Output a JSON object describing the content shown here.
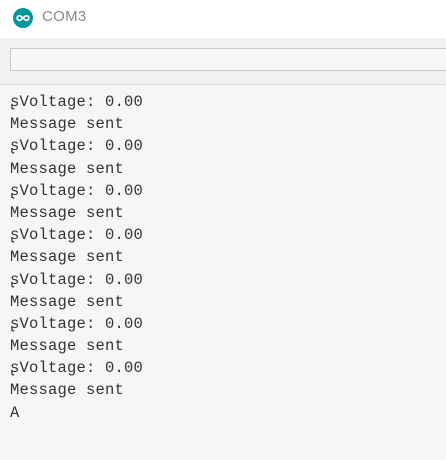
{
  "window": {
    "title": "COM3",
    "app_icon": "infinity-icon",
    "accent": "#00979c"
  },
  "send_field": {
    "value": "",
    "placeholder": ""
  },
  "output": {
    "lines": [
      "ʂVoltage: 0.00",
      "Message sent",
      "ʂVoltage: 0.00",
      "Message sent",
      "ʂVoltage: 0.00",
      "Message sent",
      "ʂVoltage: 0.00",
      "Message sent",
      "ʂVoltage: 0.00",
      "Message sent",
      "ʂVoltage: 0.00",
      "Message sent",
      "ʂVoltage: 0.00",
      "Message sent",
      "A"
    ]
  }
}
